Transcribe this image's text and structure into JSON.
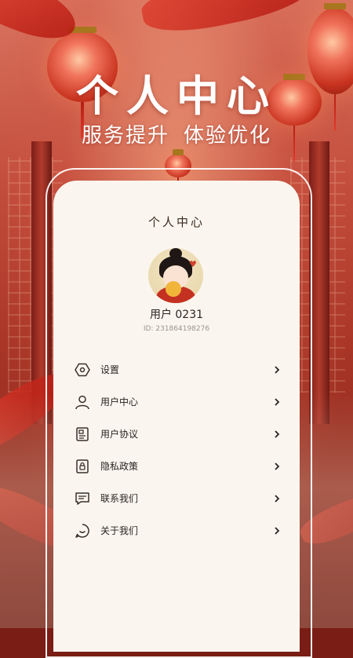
{
  "hero": {
    "title": "个人中心",
    "subtitle_left": "服务提升",
    "subtitle_right": "体验优化"
  },
  "card": {
    "title": "个人中心",
    "user_name": "用户 0231",
    "user_id": "ID: 231864198276"
  },
  "menu": [
    {
      "label": "设置",
      "icon": "settings-hexagon-icon"
    },
    {
      "label": "用户中心",
      "icon": "user-icon"
    },
    {
      "label": "用户协议",
      "icon": "agreement-document-icon"
    },
    {
      "label": "隐私政策",
      "icon": "privacy-lock-document-icon"
    },
    {
      "label": "联系我们",
      "icon": "chat-message-icon"
    },
    {
      "label": "关于我们",
      "icon": "smile-chat-icon"
    }
  ],
  "colors": {
    "card_bg": "#faf6ef",
    "accent_red": "#c24c3c",
    "text_dark": "#2a2420"
  }
}
